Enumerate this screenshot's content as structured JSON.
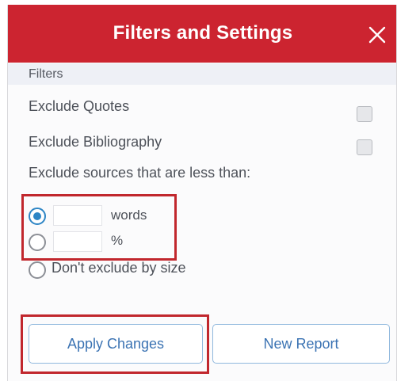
{
  "dialog": {
    "title": "Filters and Settings",
    "close_icon": "close-icon"
  },
  "filters": {
    "section_label": "Filters",
    "exclude_quotes": {
      "label": "Exclude Quotes",
      "checked": false
    },
    "exclude_bibliography": {
      "label": "Exclude Bibliography",
      "checked": false
    },
    "size_prompt": "Exclude sources that are less than:",
    "size_options": [
      {
        "value": "",
        "unit": "words",
        "selected": true
      },
      {
        "value": "",
        "unit": "%",
        "selected": false
      }
    ],
    "no_size_option": {
      "label": "Don't exclude by size",
      "selected": false
    }
  },
  "actions": {
    "apply_label": "Apply Changes",
    "new_report_label": "New Report"
  },
  "colors": {
    "header_bg": "#cc2430",
    "radio_accent": "#2d85c5",
    "highlight_red": "#c1272d",
    "button_text": "#3b73b3"
  }
}
